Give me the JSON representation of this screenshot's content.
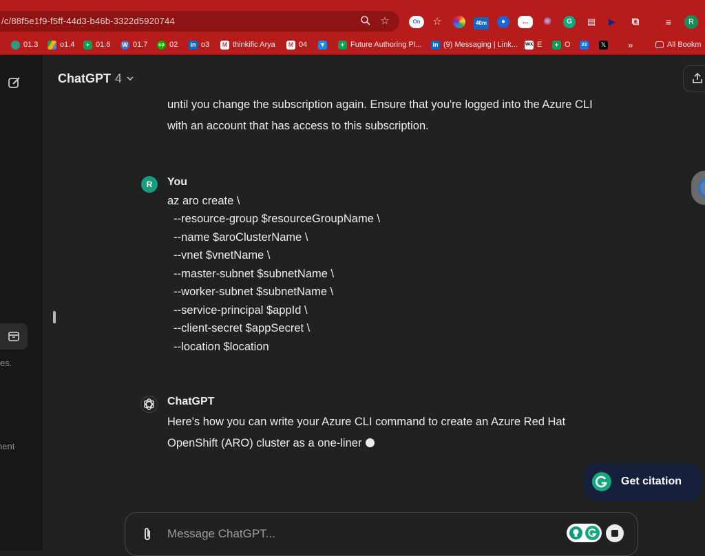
{
  "browser": {
    "url": "/c/88f5e1f9-f5ff-44d3-b46b-3322d5920744",
    "profile_initial": "R",
    "extensions": [
      "On",
      "40m",
      "..."
    ],
    "bookmarks": [
      {
        "label": "01.3",
        "color": "#6aa84f"
      },
      {
        "label": "o1.4",
        "color": "#f4b400"
      },
      {
        "label": "01.6",
        "color": "#0f9d58"
      },
      {
        "label": "01.7",
        "color": "#3c6fd1"
      },
      {
        "label": "02",
        "color": "#14a800"
      },
      {
        "label": "o3",
        "color": "#0a66c2"
      },
      {
        "label": "thinkific Arya",
        "color": "#d44638"
      },
      {
        "label": "04",
        "color": "#d44638"
      },
      {
        "label": "",
        "color": "#1e88e5"
      },
      {
        "label": "Future Authoring Pl...",
        "color": "#0f9d58"
      },
      {
        "label": "(9) Messaging | Link...",
        "color": "#0a66c2"
      },
      {
        "label": "E",
        "color": "#ffffff"
      },
      {
        "label": "O",
        "color": "#0f9d58"
      },
      {
        "label": "",
        "color": "#1a73e8"
      },
      {
        "label": "",
        "color": "#000000"
      }
    ],
    "bookmarks_overflow": "»",
    "all_bookmarks": "All Bookm"
  },
  "sidebar": {
    "fragments": [
      "es.",
      "nent"
    ]
  },
  "header": {
    "model_name": "ChatGPT",
    "model_version": "4"
  },
  "conversation": {
    "prev_assistant_tail": [
      "until you change the subscription again. Ensure that you're logged into the Azure CLI",
      "with an account that has access to this subscription."
    ],
    "user": {
      "initial": "R",
      "name": "You",
      "code_lines": [
        "az aro create \\",
        "  --resource-group $resourceGroupName \\",
        "  --name $aroClusterName \\",
        "  --vnet $vnetName \\",
        "  --master-subnet $subnetName \\",
        "  --worker-subnet $subnetName \\",
        "  --service-principal $appId \\",
        "  --client-secret $appSecret \\",
        "  --location $location"
      ]
    },
    "assistant": {
      "name": "ChatGPT",
      "lines": [
        "Here's how you can write your Azure CLI command to create an Azure Red Hat",
        "OpenShift (ARO) cluster as a one-liner"
      ]
    }
  },
  "citation": {
    "label": "Get citation"
  },
  "composer": {
    "placeholder": "Message ChatGPT..."
  }
}
